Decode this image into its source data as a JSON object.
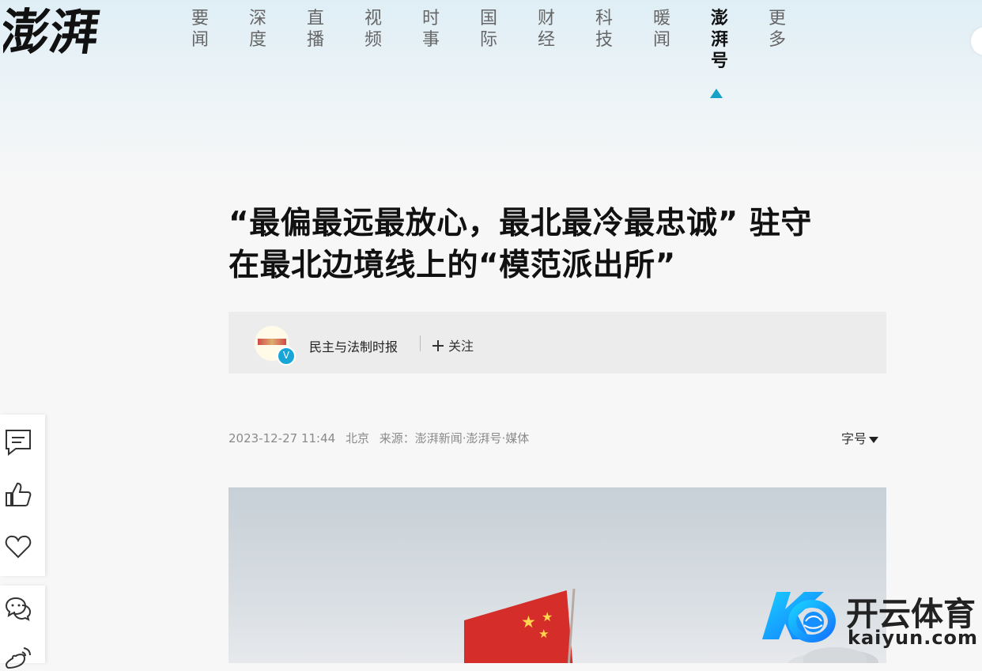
{
  "brand": {
    "logo_text": "澎湃"
  },
  "nav": {
    "items": [
      {
        "label": "要\n闻"
      },
      {
        "label": "深\n度"
      },
      {
        "label": "直\n播"
      },
      {
        "label": "视\n频"
      },
      {
        "label": "时\n事"
      },
      {
        "label": "国\n际"
      },
      {
        "label": "财\n经"
      },
      {
        "label": "科\n技"
      },
      {
        "label": "暖\n闻"
      },
      {
        "label": "澎\n湃\n号",
        "active": true
      },
      {
        "label": "更\n多"
      }
    ],
    "active_color": "#16a3c7"
  },
  "article": {
    "title_line1": "“最偏最远最放心，最北最冷最忠诚” 驻守",
    "title_line2": "在最北边境线上的“模范派出所”",
    "author": "民主与法制时报",
    "follow_label": "关注",
    "date": "2023-12-27 11:44",
    "location": "北京",
    "source": "来源：澎湃新闻·澎湃号·媒体",
    "font_size_label": "字号"
  },
  "side_tools": [
    {
      "icon": "comment-icon"
    },
    {
      "icon": "like-icon"
    },
    {
      "icon": "favorite-icon"
    },
    {
      "icon": "wechat-icon"
    },
    {
      "icon": "weibo-icon"
    }
  ],
  "watermark": {
    "text": "开云体育",
    "url": "kaiyun.com"
  }
}
